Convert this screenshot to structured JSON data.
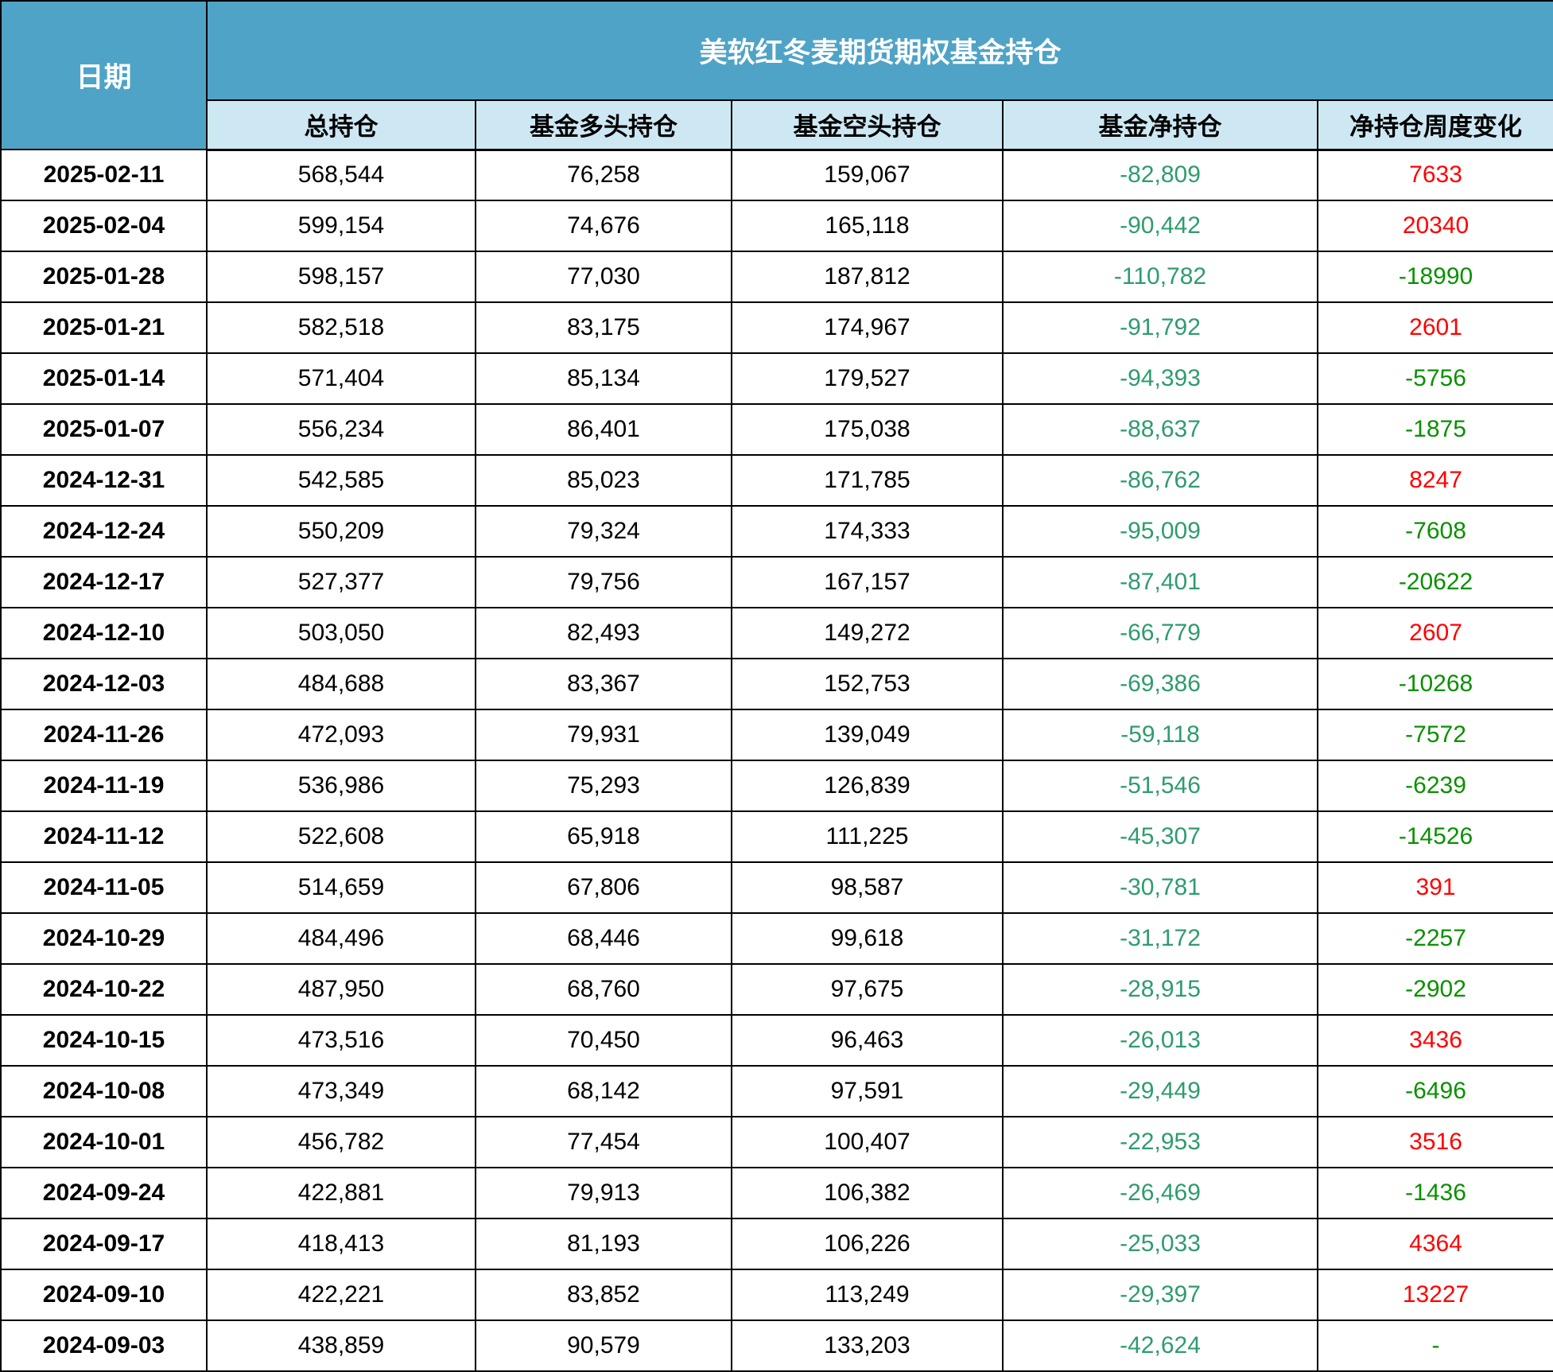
{
  "title": "美软红冬麦期货期权基金持仓",
  "date_column_header": "日期",
  "columns": [
    "总持仓",
    "基金多头持仓",
    "基金空头持仓",
    "基金净持仓",
    "净持仓周度变化"
  ],
  "colors": {
    "header_bg": "#4FA3C6",
    "subheader_bg": "#CDE8F3",
    "net_color": "#2E9C6E",
    "up_color": "#FF0000",
    "down_color": "#0A9000",
    "border_color": "#000000"
  },
  "rows": [
    {
      "date": "2025-02-11",
      "total": "568,544",
      "long": "76,258",
      "short": "159,067",
      "net": "-82,809",
      "change": "7633",
      "change_dir": "up"
    },
    {
      "date": "2025-02-04",
      "total": "599,154",
      "long": "74,676",
      "short": "165,118",
      "net": "-90,442",
      "change": "20340",
      "change_dir": "up"
    },
    {
      "date": "2025-01-28",
      "total": "598,157",
      "long": "77,030",
      "short": "187,812",
      "net": "-110,782",
      "change": "-18990",
      "change_dir": "down"
    },
    {
      "date": "2025-01-21",
      "total": "582,518",
      "long": "83,175",
      "short": "174,967",
      "net": "-91,792",
      "change": "2601",
      "change_dir": "up"
    },
    {
      "date": "2025-01-14",
      "total": "571,404",
      "long": "85,134",
      "short": "179,527",
      "net": "-94,393",
      "change": "-5756",
      "change_dir": "down"
    },
    {
      "date": "2025-01-07",
      "total": "556,234",
      "long": "86,401",
      "short": "175,038",
      "net": "-88,637",
      "change": "-1875",
      "change_dir": "down"
    },
    {
      "date": "2024-12-31",
      "total": "542,585",
      "long": "85,023",
      "short": "171,785",
      "net": "-86,762",
      "change": "8247",
      "change_dir": "up"
    },
    {
      "date": "2024-12-24",
      "total": "550,209",
      "long": "79,324",
      "short": "174,333",
      "net": "-95,009",
      "change": "-7608",
      "change_dir": "down"
    },
    {
      "date": "2024-12-17",
      "total": "527,377",
      "long": "79,756",
      "short": "167,157",
      "net": "-87,401",
      "change": "-20622",
      "change_dir": "down"
    },
    {
      "date": "2024-12-10",
      "total": "503,050",
      "long": "82,493",
      "short": "149,272",
      "net": "-66,779",
      "change": "2607",
      "change_dir": "up"
    },
    {
      "date": "2024-12-03",
      "total": "484,688",
      "long": "83,367",
      "short": "152,753",
      "net": "-69,386",
      "change": "-10268",
      "change_dir": "down"
    },
    {
      "date": "2024-11-26",
      "total": "472,093",
      "long": "79,931",
      "short": "139,049",
      "net": "-59,118",
      "change": "-7572",
      "change_dir": "down"
    },
    {
      "date": "2024-11-19",
      "total": "536,986",
      "long": "75,293",
      "short": "126,839",
      "net": "-51,546",
      "change": "-6239",
      "change_dir": "down"
    },
    {
      "date": "2024-11-12",
      "total": "522,608",
      "long": "65,918",
      "short": "111,225",
      "net": "-45,307",
      "change": "-14526",
      "change_dir": "down"
    },
    {
      "date": "2024-11-05",
      "total": "514,659",
      "long": "67,806",
      "short": "98,587",
      "net": "-30,781",
      "change": "391",
      "change_dir": "up"
    },
    {
      "date": "2024-10-29",
      "total": "484,496",
      "long": "68,446",
      "short": "99,618",
      "net": "-31,172",
      "change": "-2257",
      "change_dir": "down"
    },
    {
      "date": "2024-10-22",
      "total": "487,950",
      "long": "68,760",
      "short": "97,675",
      "net": "-28,915",
      "change": "-2902",
      "change_dir": "down"
    },
    {
      "date": "2024-10-15",
      "total": "473,516",
      "long": "70,450",
      "short": "96,463",
      "net": "-26,013",
      "change": "3436",
      "change_dir": "up"
    },
    {
      "date": "2024-10-08",
      "total": "473,349",
      "long": "68,142",
      "short": "97,591",
      "net": "-29,449",
      "change": "-6496",
      "change_dir": "down"
    },
    {
      "date": "2024-10-01",
      "total": "456,782",
      "long": "77,454",
      "short": "100,407",
      "net": "-22,953",
      "change": "3516",
      "change_dir": "up"
    },
    {
      "date": "2024-09-24",
      "total": "422,881",
      "long": "79,913",
      "short": "106,382",
      "net": "-26,469",
      "change": "-1436",
      "change_dir": "down"
    },
    {
      "date": "2024-09-17",
      "total": "418,413",
      "long": "81,193",
      "short": "106,226",
      "net": "-25,033",
      "change": "4364",
      "change_dir": "up"
    },
    {
      "date": "2024-09-10",
      "total": "422,221",
      "long": "83,852",
      "short": "113,249",
      "net": "-29,397",
      "change": "13227",
      "change_dir": "up"
    },
    {
      "date": "2024-09-03",
      "total": "438,859",
      "long": "90,579",
      "short": "133,203",
      "net": "-42,624",
      "change": "-",
      "change_dir": "flat"
    }
  ],
  "chart_data": {
    "type": "table",
    "title": "美软红冬麦期货期权基金持仓",
    "columns": [
      "日期",
      "总持仓",
      "基金多头持仓",
      "基金空头持仓",
      "基金净持仓",
      "净持仓周度变化"
    ],
    "rows": [
      [
        "2025-02-11",
        568544,
        76258,
        159067,
        -82809,
        7633
      ],
      [
        "2025-02-04",
        599154,
        74676,
        165118,
        -90442,
        20340
      ],
      [
        "2025-01-28",
        598157,
        77030,
        187812,
        -110782,
        -18990
      ],
      [
        "2025-01-21",
        582518,
        83175,
        174967,
        -91792,
        2601
      ],
      [
        "2025-01-14",
        571404,
        85134,
        179527,
        -94393,
        -5756
      ],
      [
        "2025-01-07",
        556234,
        86401,
        175038,
        -88637,
        -1875
      ],
      [
        "2024-12-31",
        542585,
        85023,
        171785,
        -86762,
        8247
      ],
      [
        "2024-12-24",
        550209,
        79324,
        174333,
        -95009,
        -7608
      ],
      [
        "2024-12-17",
        527377,
        79756,
        167157,
        -87401,
        -20622
      ],
      [
        "2024-12-10",
        503050,
        82493,
        149272,
        -66779,
        2607
      ],
      [
        "2024-12-03",
        484688,
        83367,
        152753,
        -69386,
        -10268
      ],
      [
        "2024-11-26",
        472093,
        79931,
        139049,
        -59118,
        -7572
      ],
      [
        "2024-11-19",
        536986,
        75293,
        126839,
        -51546,
        -6239
      ],
      [
        "2024-11-12",
        522608,
        65918,
        111225,
        -45307,
        -14526
      ],
      [
        "2024-11-05",
        514659,
        67806,
        98587,
        -30781,
        391
      ],
      [
        "2024-10-29",
        484496,
        68446,
        99618,
        -31172,
        -2257
      ],
      [
        "2024-10-22",
        487950,
        68760,
        97675,
        -28915,
        -2902
      ],
      [
        "2024-10-15",
        473516,
        70450,
        96463,
        -26013,
        3436
      ],
      [
        "2024-10-08",
        473349,
        68142,
        97591,
        -29449,
        -6496
      ],
      [
        "2024-10-01",
        456782,
        77454,
        100407,
        -22953,
        3516
      ],
      [
        "2024-09-24",
        422881,
        79913,
        106382,
        -26469,
        -1436
      ],
      [
        "2024-09-17",
        418413,
        81193,
        106226,
        -25033,
        4364
      ],
      [
        "2024-09-10",
        422221,
        83852,
        113249,
        -29397,
        13227
      ],
      [
        "2024-09-03",
        438859,
        90579,
        133203,
        -42624,
        null
      ]
    ]
  }
}
